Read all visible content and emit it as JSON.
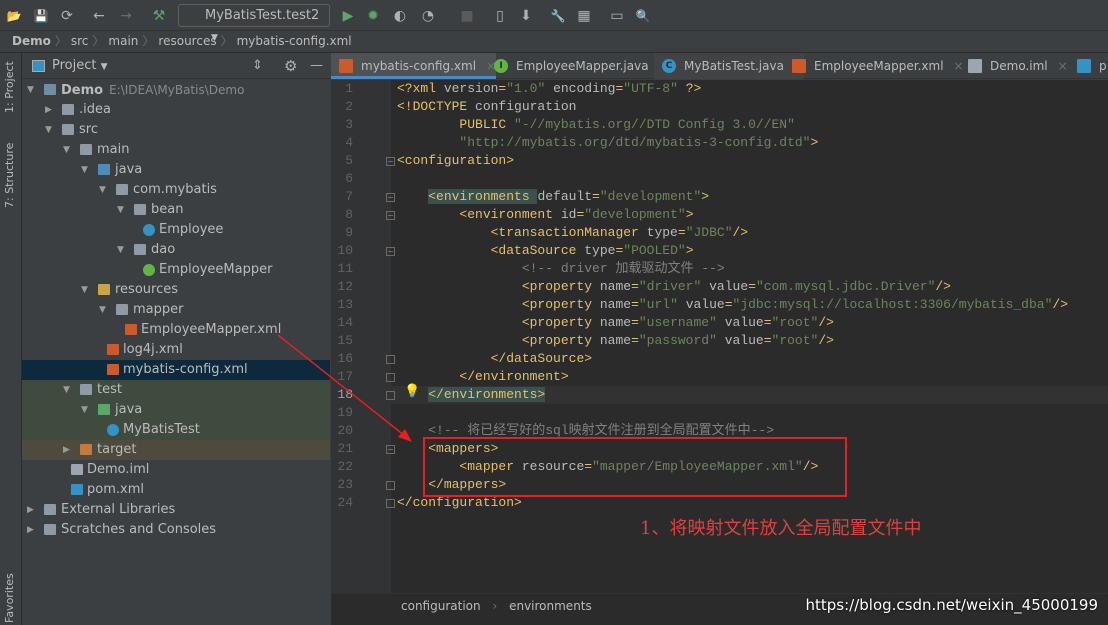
{
  "toolbar": {
    "run_config": "MyBatisTest.test2",
    "icons": [
      "open-folder-icon",
      "save-icon",
      "sync-icon",
      "back-icon",
      "forward-icon",
      "build-hammer-icon",
      "run-icon",
      "debug-icon",
      "coverage-icon",
      "profile-icon",
      "stop-icon",
      "device-icon",
      "deploy-icon",
      "settings-wrench-icon",
      "project-structure-icon",
      "terminal-icon",
      "search-icon"
    ]
  },
  "breadcrumb": [
    "Demo",
    "src",
    "main",
    "resources",
    "mybatis-config.xml"
  ],
  "left_strip": {
    "project": "1: Project",
    "structure": "7: Structure",
    "favorites": "Favorites"
  },
  "project_panel": {
    "title": "Project"
  },
  "tree": [
    {
      "label": "Demo",
      "hint": "E:\\IDEA\\MyBatis\\Demo",
      "level": 0,
      "state": "expanded",
      "icon": "module"
    },
    {
      "label": ".idea",
      "level": 1,
      "state": "collapsed",
      "icon": "folder"
    },
    {
      "label": "src",
      "level": 1,
      "state": "expanded",
      "icon": "folder"
    },
    {
      "label": "main",
      "level": 2,
      "state": "expanded",
      "icon": "folder"
    },
    {
      "label": "java",
      "level": 3,
      "state": "expanded",
      "icon": "source-folder"
    },
    {
      "label": "com.mybatis",
      "level": 4,
      "state": "expanded",
      "icon": "package"
    },
    {
      "label": "bean",
      "level": 5,
      "state": "expanded",
      "icon": "package"
    },
    {
      "label": "Employee",
      "level": 6,
      "state": "leaf",
      "icon": "class"
    },
    {
      "label": "dao",
      "level": 5,
      "state": "expanded",
      "icon": "package"
    },
    {
      "label": "EmployeeMapper",
      "level": 6,
      "state": "leaf",
      "icon": "interface"
    },
    {
      "label": "resources",
      "level": 3,
      "state": "expanded",
      "icon": "resources-folder"
    },
    {
      "label": "mapper",
      "level": 4,
      "state": "expanded",
      "icon": "folder"
    },
    {
      "label": "EmployeeMapper.xml",
      "level": 5,
      "state": "leaf",
      "icon": "xml"
    },
    {
      "label": "log4j.xml",
      "level": 4,
      "state": "leaf",
      "icon": "xml"
    },
    {
      "label": "mybatis-config.xml",
      "level": 4,
      "state": "leaf",
      "icon": "xml",
      "selected": true
    },
    {
      "label": "test",
      "level": 2,
      "state": "expanded",
      "icon": "folder",
      "bg": "test"
    },
    {
      "label": "java",
      "level": 3,
      "state": "expanded",
      "icon": "test-folder",
      "bg": "test"
    },
    {
      "label": "MyBatisTest",
      "level": 4,
      "state": "leaf",
      "icon": "test-class",
      "bg": "test"
    },
    {
      "label": "target",
      "level": 2,
      "state": "collapsed",
      "icon": "excluded-folder",
      "bg": "target"
    },
    {
      "label": "Demo.iml",
      "level": 2,
      "state": "leaf",
      "icon": "iml"
    },
    {
      "label": "pom.xml",
      "level": 2,
      "state": "leaf",
      "icon": "maven"
    },
    {
      "label": "External Libraries",
      "level": 0,
      "state": "collapsed",
      "icon": "libraries"
    },
    {
      "label": "Scratches and Consoles",
      "level": 0,
      "state": "collapsed",
      "icon": "scratches"
    }
  ],
  "tabs": [
    {
      "label": "mybatis-config.xml",
      "icon": "xml",
      "active": true
    },
    {
      "label": "EmployeeMapper.java",
      "icon": "interface"
    },
    {
      "label": "MyBatisTest.java",
      "icon": "test-class"
    },
    {
      "label": "EmployeeMapper.xml",
      "icon": "xml"
    },
    {
      "label": "Demo.iml",
      "icon": "iml"
    },
    {
      "label": "p",
      "icon": "maven"
    }
  ],
  "code": [
    [
      [
        "t",
        "<?xml "
      ],
      [
        "a",
        "version"
      ],
      [
        "t",
        "="
      ],
      [
        "v",
        "\"1.0\""
      ],
      [
        "t",
        " "
      ],
      [
        "a",
        "encoding"
      ],
      [
        "t",
        "="
      ],
      [
        "v",
        "\"UTF-8\""
      ],
      [
        "t",
        " ?>"
      ]
    ],
    [
      [
        "t",
        "<!DOCTYPE "
      ],
      [
        "a",
        "configuration"
      ]
    ],
    [
      [
        "p",
        "        "
      ],
      [
        "t",
        "PUBLIC "
      ],
      [
        "v",
        "\"-//mybatis.org//DTD Config 3.0//EN\""
      ]
    ],
    [
      [
        "p",
        "        "
      ],
      [
        "v",
        "\"http://mybatis.org/dtd/mybatis-3-config.dtd\""
      ],
      [
        "t",
        ">"
      ]
    ],
    [
      [
        "t",
        "<configuration>"
      ]
    ],
    [],
    [
      [
        "p",
        "    "
      ],
      [
        "t",
        "<environments "
      ],
      [
        "a",
        "default"
      ],
      [
        "t",
        "="
      ],
      [
        "v",
        "\"development\""
      ],
      [
        "t",
        ">"
      ]
    ],
    [
      [
        "p",
        "        "
      ],
      [
        "t",
        "<environment "
      ],
      [
        "a",
        "id"
      ],
      [
        "t",
        "="
      ],
      [
        "v",
        "\"development\""
      ],
      [
        "t",
        ">"
      ]
    ],
    [
      [
        "p",
        "            "
      ],
      [
        "t",
        "<transactionManager "
      ],
      [
        "a",
        "type"
      ],
      [
        "t",
        "="
      ],
      [
        "v",
        "\"JDBC\""
      ],
      [
        "t",
        "/>"
      ]
    ],
    [
      [
        "p",
        "            "
      ],
      [
        "t",
        "<dataSource "
      ],
      [
        "a",
        "type"
      ],
      [
        "t",
        "="
      ],
      [
        "v",
        "\"POOLED\""
      ],
      [
        "t",
        ">"
      ]
    ],
    [
      [
        "p",
        "                "
      ],
      [
        "c",
        "<!-- driver 加载驱动文件 -->"
      ]
    ],
    [
      [
        "p",
        "                "
      ],
      [
        "t",
        "<property "
      ],
      [
        "a",
        "name"
      ],
      [
        "t",
        "="
      ],
      [
        "v",
        "\"driver\""
      ],
      [
        "t",
        " "
      ],
      [
        "a",
        "value"
      ],
      [
        "t",
        "="
      ],
      [
        "v",
        "\"com.mysql.jdbc.Driver\""
      ],
      [
        "t",
        "/>"
      ]
    ],
    [
      [
        "p",
        "                "
      ],
      [
        "t",
        "<property "
      ],
      [
        "a",
        "name"
      ],
      [
        "t",
        "="
      ],
      [
        "v",
        "\"url\""
      ],
      [
        "t",
        " "
      ],
      [
        "a",
        "value"
      ],
      [
        "t",
        "="
      ],
      [
        "v",
        "\"jdbc:mysql://localhost:3306/mybatis_dba\""
      ],
      [
        "t",
        "/>"
      ]
    ],
    [
      [
        "p",
        "                "
      ],
      [
        "t",
        "<property "
      ],
      [
        "a",
        "name"
      ],
      [
        "t",
        "="
      ],
      [
        "v",
        "\"username\""
      ],
      [
        "t",
        " "
      ],
      [
        "a",
        "value"
      ],
      [
        "t",
        "="
      ],
      [
        "v",
        "\"root\""
      ],
      [
        "t",
        "/>"
      ]
    ],
    [
      [
        "p",
        "                "
      ],
      [
        "t",
        "<property "
      ],
      [
        "a",
        "name"
      ],
      [
        "t",
        "="
      ],
      [
        "v",
        "\"password\""
      ],
      [
        "t",
        " "
      ],
      [
        "a",
        "value"
      ],
      [
        "t",
        "="
      ],
      [
        "v",
        "\"root\""
      ],
      [
        "t",
        "/>"
      ]
    ],
    [
      [
        "p",
        "            "
      ],
      [
        "t",
        "</dataSource>"
      ]
    ],
    [
      [
        "p",
        "        "
      ],
      [
        "t",
        "</environment>"
      ]
    ],
    [
      [
        "p",
        "    "
      ],
      [
        "t",
        "</environments>"
      ]
    ],
    [],
    [
      [
        "p",
        "    "
      ],
      [
        "c",
        "<!-- 将已经写好的sql映射文件注册到全局配置文件中-->"
      ]
    ],
    [
      [
        "p",
        "    "
      ],
      [
        "t",
        "<mappers>"
      ]
    ],
    [
      [
        "p",
        "        "
      ],
      [
        "t",
        "<mapper "
      ],
      [
        "a",
        "resource"
      ],
      [
        "t",
        "="
      ],
      [
        "v",
        "\"mapper/EmployeeMapper.xml\""
      ],
      [
        "t",
        "/>"
      ]
    ],
    [
      [
        "p",
        "    "
      ],
      [
        "t",
        "</mappers>"
      ]
    ],
    [
      [
        "t",
        "</configuration>"
      ]
    ]
  ],
  "current_line": 18,
  "annotation": "1、将映射文件放入全局配置文件中",
  "editor_breadcrumb": [
    "configuration",
    "environments"
  ],
  "watermark": "https://blog.csdn.net/weixin_45000199",
  "colors": {
    "tag": "#e8bf6a",
    "attr": "#bababa",
    "value": "#6a8759",
    "comment": "#808080",
    "annotation": "#e5201e"
  }
}
